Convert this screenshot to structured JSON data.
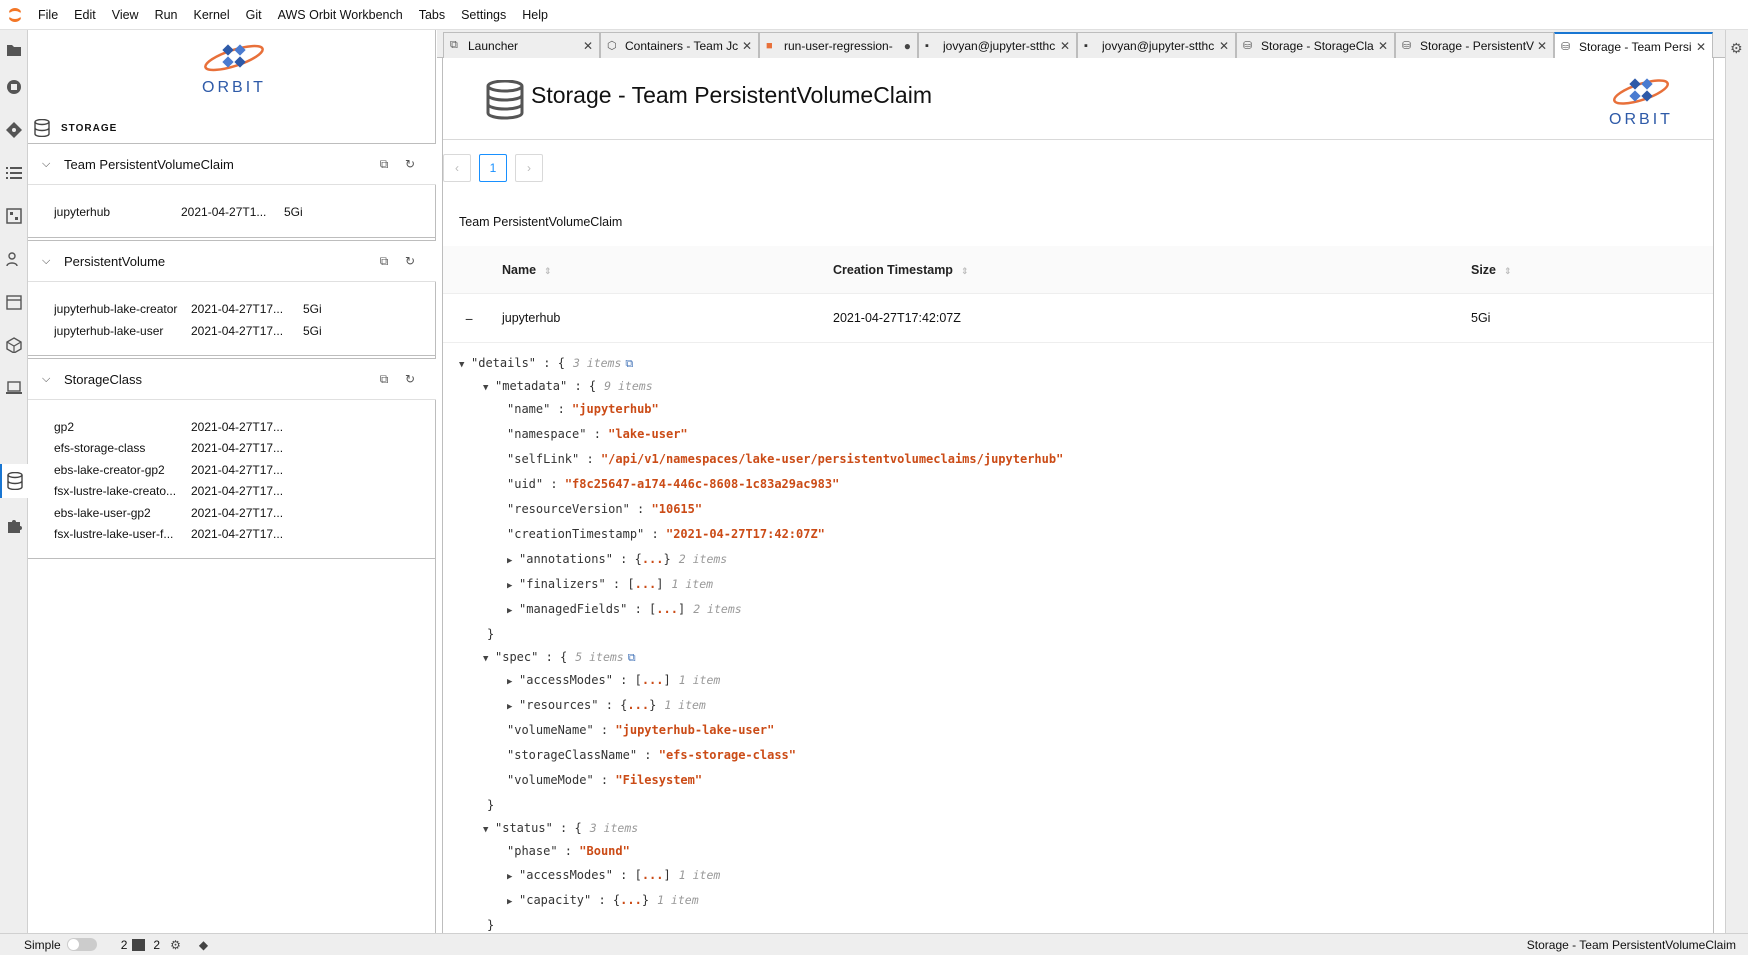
{
  "menu": [
    "File",
    "Edit",
    "View",
    "Run",
    "Kernel",
    "Git",
    "AWS Orbit Workbench",
    "Tabs",
    "Settings",
    "Help"
  ],
  "left_panel": {
    "logo_text": "ORBIT",
    "title": "STORAGE",
    "sections": [
      {
        "title": "Team PersistentVolumeClaim",
        "rows": [
          [
            "jupyterhub",
            "2021-04-27T1...",
            "5Gi"
          ]
        ]
      },
      {
        "title": "PersistentVolume",
        "rows": [
          [
            "jupyterhub-lake-creator",
            "2021-04-27T17...",
            "5Gi"
          ],
          [
            "jupyterhub-lake-user",
            "2021-04-27T17...",
            "5Gi"
          ]
        ]
      },
      {
        "title": "StorageClass",
        "rows": [
          [
            "gp2",
            "2021-04-27T17...",
            ""
          ],
          [
            "efs-storage-class",
            "2021-04-27T17...",
            ""
          ],
          [
            "ebs-lake-creator-gp2",
            "2021-04-27T17...",
            ""
          ],
          [
            "fsx-lustre-lake-creato...",
            "2021-04-27T17...",
            ""
          ],
          [
            "ebs-lake-user-gp2",
            "2021-04-27T17...",
            ""
          ],
          [
            "fsx-lustre-lake-user-f...",
            "2021-04-27T17...",
            ""
          ]
        ]
      }
    ]
  },
  "tabs": [
    {
      "label": "Launcher",
      "icon": "launcher-icon"
    },
    {
      "label": "Containers - Team Jc",
      "icon": "cube-icon"
    },
    {
      "label": "run-user-regression-",
      "icon": "notebook-icon"
    },
    {
      "label": "jovyan@jupyter-stthc",
      "icon": "terminal-icon"
    },
    {
      "label": "jovyan@jupyter-stthc",
      "icon": "terminal-icon"
    },
    {
      "label": "Storage - StorageCla",
      "icon": "database-icon"
    },
    {
      "label": "Storage - PersistentV",
      "icon": "database-icon"
    },
    {
      "label": "Storage - Team Persi",
      "icon": "database-icon"
    }
  ],
  "main": {
    "title": "Storage - Team PersistentVolumeClaim",
    "logo_text": "ORBIT",
    "page": "1",
    "caption": "Team PersistentVolumeClaim",
    "columns": [
      "Name",
      "Creation Timestamp",
      "Size"
    ],
    "row": {
      "name": "jupyterhub",
      "timestamp": "2021-04-27T17:42:07Z",
      "size": "5Gi",
      "expander": "−"
    }
  },
  "json_view": {
    "details": "\"details\"",
    "details_count": "3 items",
    "metadata": "\"metadata\"",
    "metadata_count": "9 items",
    "name_k": "\"name\"",
    "name_v": "\"jupyterhub\"",
    "namespace_k": "\"namespace\"",
    "namespace_v": "\"lake-user\"",
    "selfLink_k": "\"selfLink\"",
    "selfLink_v": "\"/api/v1/namespaces/lake-user/persistentvolumeclaims/jupyterhub\"",
    "uid_k": "\"uid\"",
    "uid_v": "\"f8c25647-a174-446c-8608-1c83a29ac983\"",
    "rv_k": "\"resourceVersion\"",
    "rv_v": "\"10615\"",
    "ct_k": "\"creationTimestamp\"",
    "ct_v": "\"2021-04-27T17:42:07Z\"",
    "annotations_k": "\"annotations\"",
    "annotations_count": "2 items",
    "finalizers_k": "\"finalizers\"",
    "finalizers_count": "1 item",
    "managedFields_k": "\"managedFields\"",
    "managedFields_count": "2 items",
    "spec": "\"spec\"",
    "spec_count": "5 items",
    "accessModes_k": "\"accessModes\"",
    "accessModes_count": "1 item",
    "resources_k": "\"resources\"",
    "resources_count": "1 item",
    "volumeName_k": "\"volumeName\"",
    "volumeName_v": "\"jupyterhub-lake-user\"",
    "scn_k": "\"storageClassName\"",
    "scn_v": "\"efs-storage-class\"",
    "volumeMode_k": "\"volumeMode\"",
    "volumeMode_v": "\"Filesystem\"",
    "status": "\"status\"",
    "status_count": "3 items",
    "phase_k": "\"phase\"",
    "phase_v": "\"Bound\"",
    "sam_k": "\"accessModes\"",
    "sam_count": "1 item",
    "capacity_k": "\"capacity\"",
    "capacity_count": "1 item"
  },
  "statusbar": {
    "mode_label": "Simple",
    "kernels": "2",
    "terminals": "2",
    "right_text": "Storage - Team PersistentVolumeClaim"
  },
  "colors": {
    "accent": "#1976d2",
    "json_string": "#cb4b16",
    "orbit_blue": "#2e5aa8",
    "orbit_orange": "#e8703a"
  }
}
